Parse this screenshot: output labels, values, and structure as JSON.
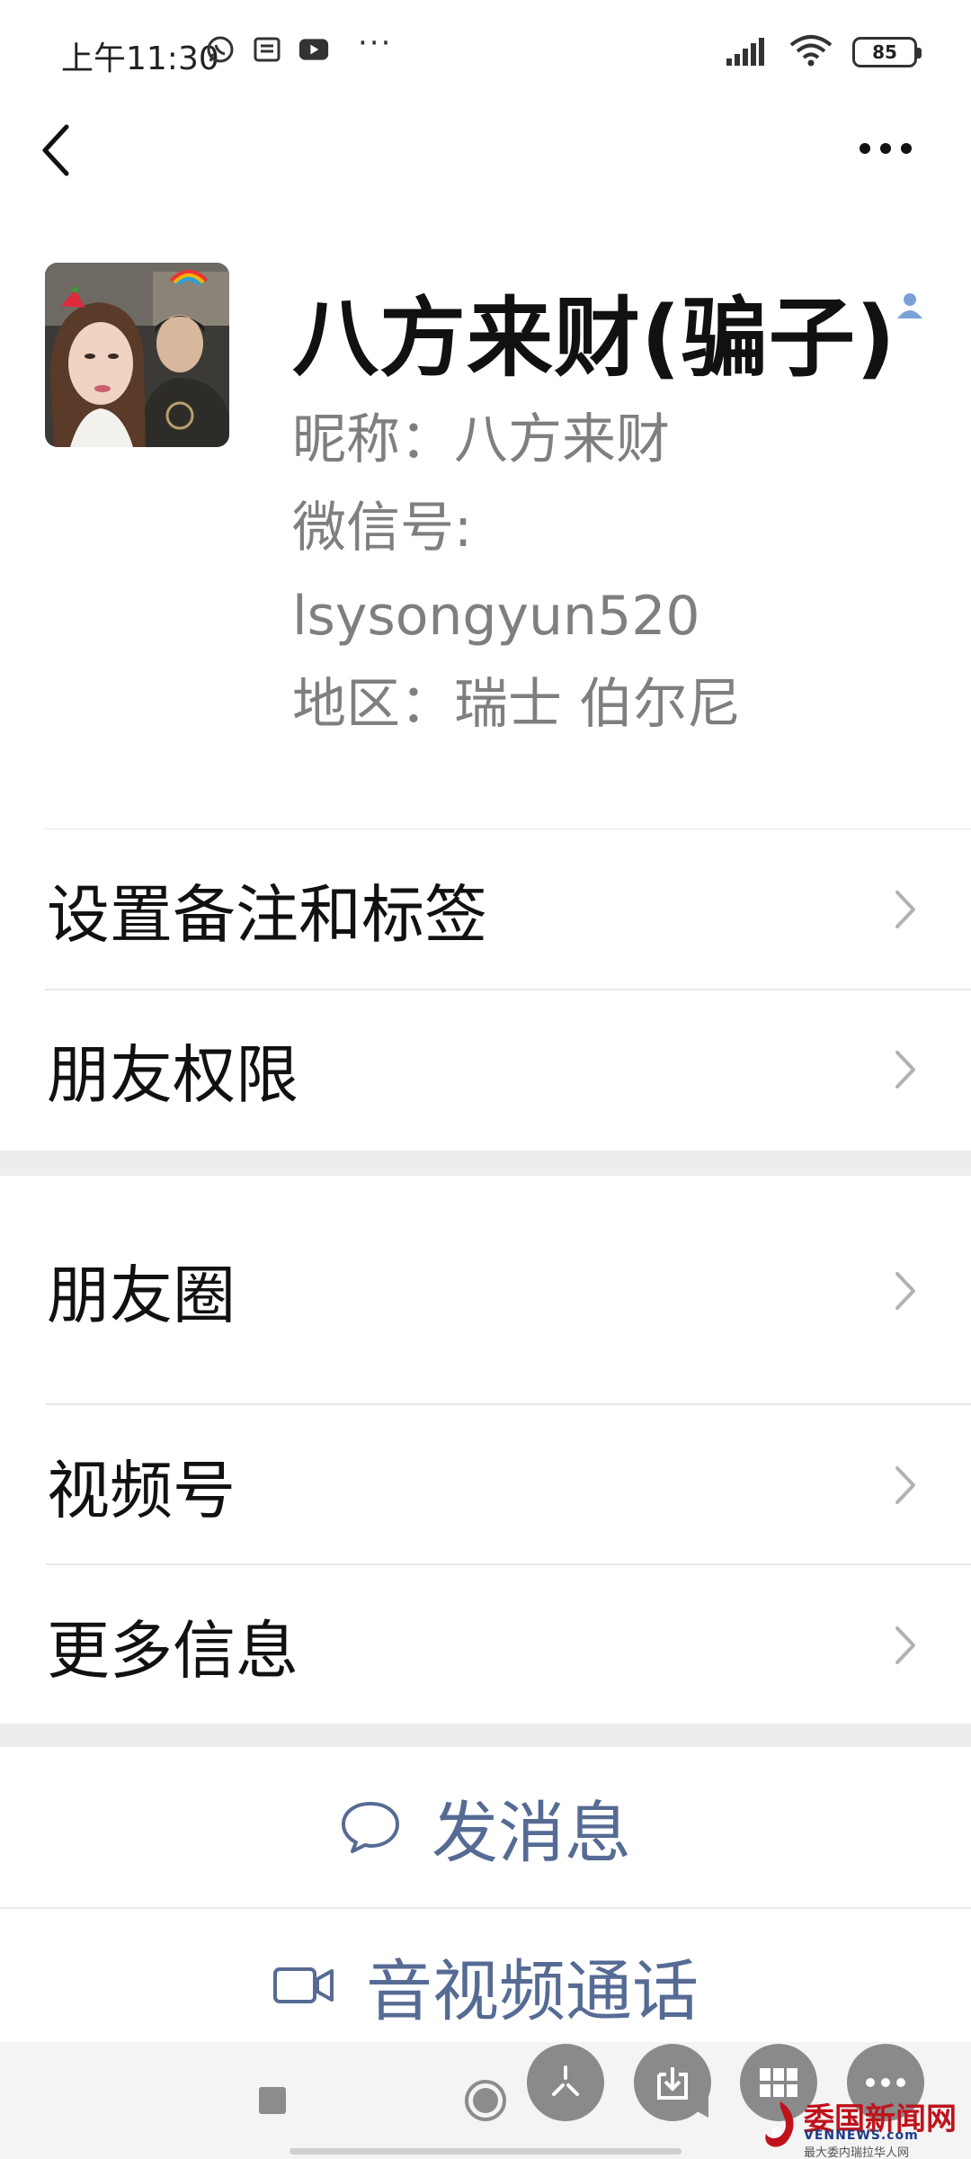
{
  "status_bar": {
    "time": "上午11:30",
    "more": "···",
    "battery": "85"
  },
  "profile": {
    "name": "八方来财(骗子)",
    "nickname": "昵称：八方来财",
    "wechat_id_label": "微信号:",
    "wechat_id": "lsysongyun520",
    "region": "地区：瑞士  伯尔尼"
  },
  "menu": {
    "section1": [
      {
        "label": "设置备注和标签"
      },
      {
        "label": "朋友权限"
      }
    ],
    "section2": [
      {
        "label": "朋友圈"
      },
      {
        "label": "视频号"
      },
      {
        "label": "更多信息"
      }
    ]
  },
  "actions": {
    "message": "发消息",
    "call": "音视频通话"
  },
  "watermark": {
    "name": "委国新闻网",
    "site": "VENNEWS.com",
    "sub": "最大委内瑞拉华人网"
  },
  "colors": {
    "accent": "#566b94",
    "secondary_text": "#7f7f7f",
    "section_gap": "#ededed"
  }
}
